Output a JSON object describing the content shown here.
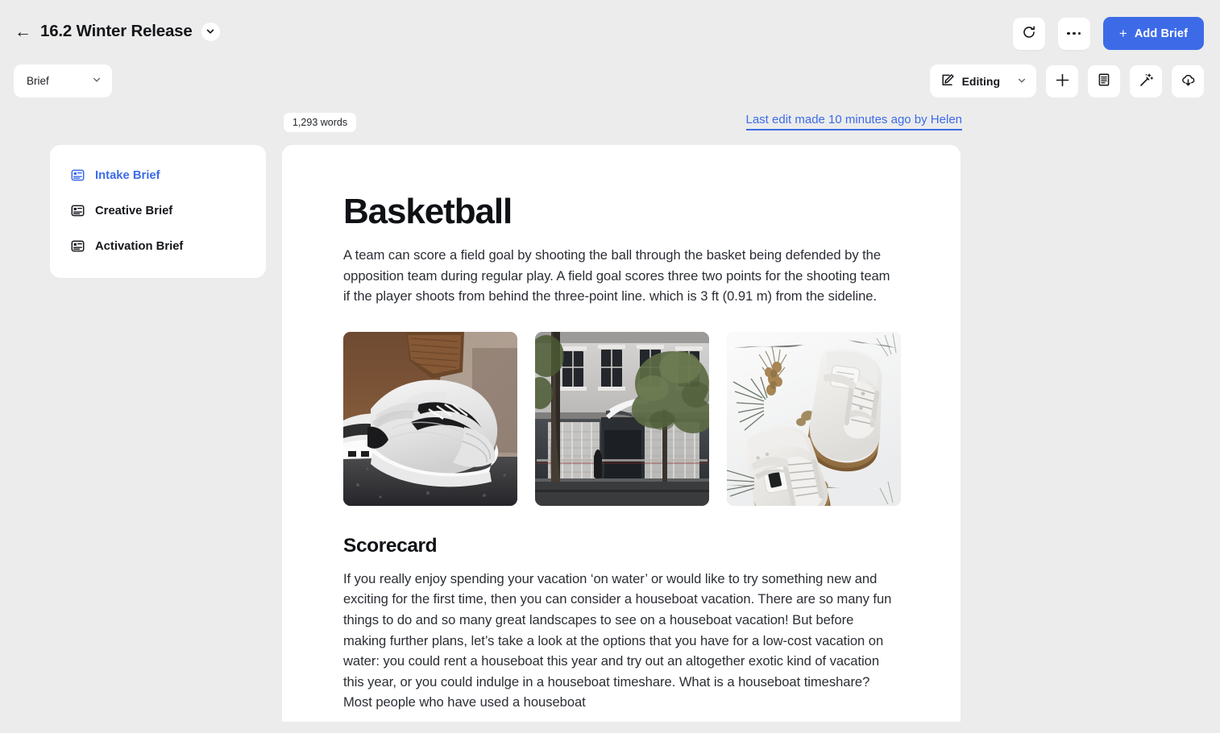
{
  "header": {
    "back_icon": "arrow-left-icon",
    "title": "16.2 Winter Release",
    "title_chevron_icon": "chevron-down-icon",
    "refresh_icon": "refresh-icon",
    "more_icon": "ellipsis-icon",
    "add_brief_label": "Add Brief",
    "add_brief_plus": "+",
    "accent_color": "#3d6be8"
  },
  "toolbar": {
    "brief_select_value": "Brief",
    "brief_select_chevron": "chevron-down-icon",
    "editing_label": "Editing",
    "editing_icon": "pencil-square-icon",
    "editing_chevron": "chevron-down-icon",
    "add_icon": "plus-icon",
    "notes_icon": "document-icon",
    "magic_icon": "magic-wand-icon",
    "download_icon": "cloud-download-icon"
  },
  "meta": {
    "word_count": "1,293 words",
    "last_edit": "Last edit made 10 minutes ago by Helen"
  },
  "sidebar": {
    "items": [
      {
        "label": "Intake Brief",
        "icon": "document-icon",
        "active": true
      },
      {
        "label": "Creative Brief",
        "icon": "document-icon",
        "active": false
      },
      {
        "label": "Activation Brief",
        "icon": "document-icon",
        "active": false
      }
    ]
  },
  "document": {
    "heading": "Basketball",
    "paragraph1": "A team can score a field goal by shooting the ball through the basket being defended by the opposition team during regular play. A field goal scores three two points for the shooting team if the player shoots from behind the three-point line. which is 3 ft (0.91 m) from the sideline.",
    "images": [
      {
        "alt": "white nike sneakers on feet with brown pants on asphalt"
      },
      {
        "alt": "nike storefront building facade with trees"
      },
      {
        "alt": "white nike high-top sneakers with gum soles on snow"
      }
    ],
    "heading2": "Scorecard",
    "paragraph2": "If you really enjoy spending your vacation ‘on water’ or would like to try something new and exciting for the first time, then you can consider a houseboat vacation. There are so many fun things to do and so many great landscapes to see on a houseboat vacation! But before making further plans, let’s take a look at the options that you have for a low-cost vacation on water: you could rent a houseboat this year and try out an altogether exotic kind of vacation this year, or you could indulge in a houseboat timeshare. What is a houseboat timeshare? Most people who have used a houseboat"
  }
}
